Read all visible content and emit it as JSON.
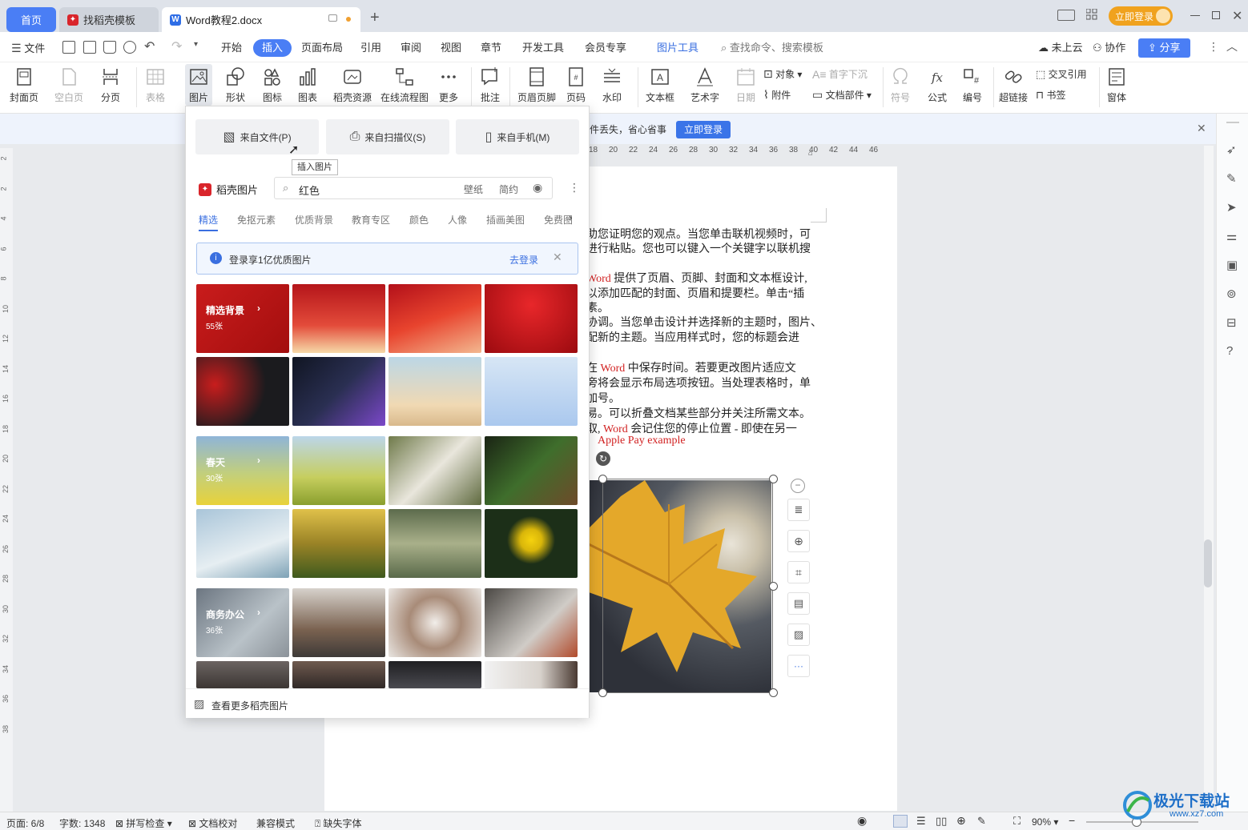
{
  "titlebar": {
    "tabs": [
      {
        "label": "首页"
      },
      {
        "label": "找稻壳模板"
      },
      {
        "label": "Word教程2.docx"
      }
    ],
    "login_button": "立即登录"
  },
  "menubar": {
    "file": "文件",
    "items": [
      "开始",
      "插入",
      "页面布局",
      "引用",
      "审阅",
      "视图",
      "章节",
      "开发工具",
      "会员专享"
    ],
    "active": "插入",
    "picture_tools": "图片工具",
    "search_placeholder": "查找命令、搜索模板",
    "cloud": "未上云",
    "collab": "协作",
    "share": "分享"
  },
  "ribbon": {
    "cover": "封面页",
    "blank": "空白页",
    "pagebreak": "分页",
    "table": "表格",
    "picture": "图片",
    "shape": "形状",
    "icon": "图标",
    "chart": "图表",
    "daoke": "稻壳资源",
    "flow": "在线流程图",
    "more": "更多",
    "comment": "批注",
    "header": "页眉页脚",
    "pagenum": "页码",
    "watermark": "水印",
    "textbox": "文本框",
    "art": "艺术字",
    "date": "日期",
    "object": "对象",
    "attach": "附件",
    "dropcap": "首字下沉",
    "docpart": "文档部件",
    "symbol": "符号",
    "formula": "公式",
    "number": "编号",
    "crossref": "交叉引用",
    "bookmark": "书签",
    "hyperlink": "超链接",
    "window": "窗体"
  },
  "notif": {
    "text": "件丢失，省心省事",
    "button": "立即登录"
  },
  "popup": {
    "sources": [
      "来自文件(P)",
      "来自扫描仪(S)",
      "来自手机(M)"
    ],
    "tooltip": "插入图片",
    "brand": "稻壳图片",
    "search_value": "红色",
    "search_chip1": "壁纸",
    "search_chip2": "简约",
    "categories": [
      "精选",
      "免抠元素",
      "优质背景",
      "教育专区",
      "颜色",
      "人像",
      "插画美图",
      "免费图"
    ],
    "login_hint": "登录享1亿优质图片",
    "login_link": "去登录",
    "groups": [
      {
        "title": "精选背景",
        "count": "55张"
      },
      {
        "title": "春天",
        "count": "30张"
      },
      {
        "title": "商务办公",
        "count": "36张"
      }
    ],
    "more": "查看更多稻壳图片"
  },
  "ruler": [
    "18",
    "20",
    "22",
    "24",
    "26",
    "28",
    "30",
    "32",
    "34",
    "36",
    "38",
    "40",
    "42",
    "44",
    "46"
  ],
  "vruler": [
    "2",
    "2",
    "4",
    "6",
    "8",
    "10",
    "12",
    "14",
    "16",
    "18",
    "20",
    "22",
    "24",
    "26",
    "28",
    "30",
    "32",
    "34",
    "36",
    "38"
  ],
  "document": {
    "lines": [
      "助您证明您的观点。当您单击联机视频时，可",
      "进行粘贴。您也可以键入一个关键字以联机搜",
      "",
      "Word 提供了页眉、页脚、封面和文本框设计,",
      "以添加匹配的封面、页眉和提要栏。单击“插",
      "素。",
      "协调。当您单击设计并选择新的主题时，图片、",
      "配新的主题。当应用样式时，您的标题会进",
      "",
      "在 Word 中保存时间。若要更改图片适应文",
      "旁将会显示布局选项按钮。当处理表格时，单",
      "加号。",
      "易。可以折叠文档某些部分并关注所需文本。",
      "取, Word 会记住您的停止位置 - 即使在另一",
      "Apple Pay   example"
    ]
  },
  "status": {
    "page": "页面: 6/8",
    "words": "字数: 1348",
    "spell": "拼写检查",
    "proof": "文档校对",
    "compat": "兼容模式",
    "font": "缺失字体",
    "zoom": "90%"
  },
  "watermark": {
    "text": "极光下载站",
    "url": "www.xz7.com"
  }
}
